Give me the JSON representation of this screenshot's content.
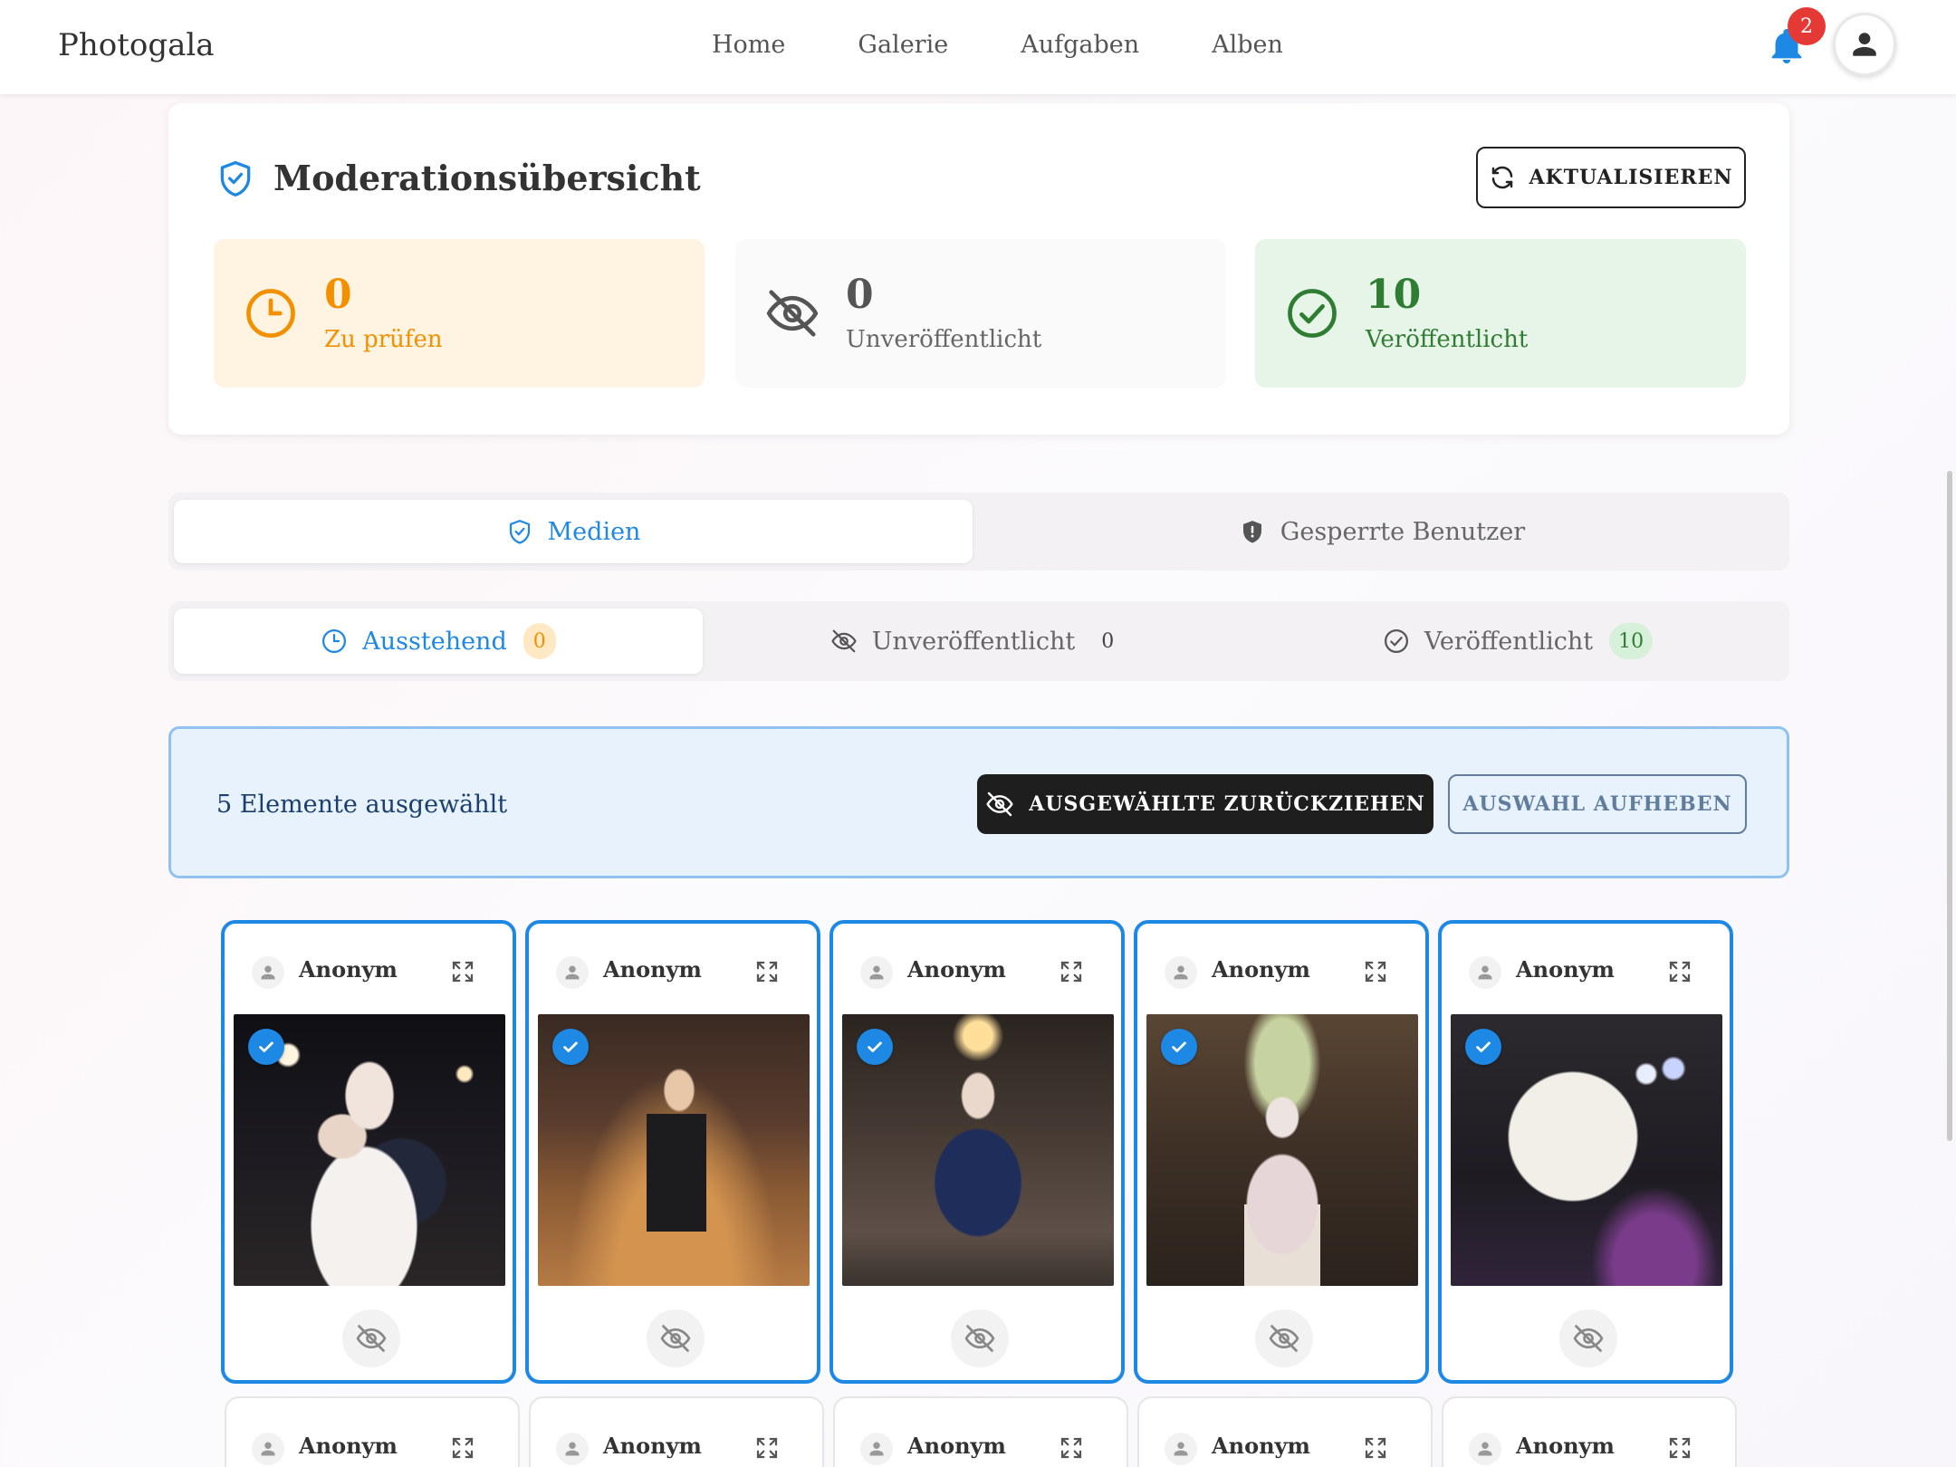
{
  "app": {
    "title": "Photogala"
  },
  "nav": {
    "items": [
      "Home",
      "Galerie",
      "Aufgaben",
      "Alben"
    ]
  },
  "notifications": {
    "count": "2"
  },
  "overview": {
    "title": "Moderationsübersicht",
    "refresh_label": "AKTUALISIEREN",
    "stats": [
      {
        "value": "0",
        "label": "Zu prüfen",
        "icon": "clock-icon",
        "color": "#f29000"
      },
      {
        "value": "0",
        "label": "Unveröffentlicht",
        "icon": "eye-off-icon",
        "color": "#555555"
      },
      {
        "value": "10",
        "label": "Veröffentlicht",
        "icon": "check-circle-icon",
        "color": "#2e7d32"
      }
    ]
  },
  "main_tabs": [
    {
      "label": "Medien",
      "icon": "shield-check-icon",
      "active": true
    },
    {
      "label": "Gesperrte Benutzer",
      "icon": "shield-alert-icon",
      "active": false
    }
  ],
  "status_tabs": [
    {
      "label": "Ausstehend",
      "count": "0",
      "icon": "clock-icon",
      "active": true
    },
    {
      "label": "Unveröffentlicht",
      "count": "0",
      "icon": "eye-off-icon",
      "active": false
    },
    {
      "label": "Veröffentlicht",
      "count": "10",
      "icon": "check-circle-icon",
      "active": false
    }
  ],
  "selection": {
    "text": "5 Elemente ausgewählt",
    "withdraw_label": "AUSGEWÄHLTE ZURÜCKZIEHEN",
    "clear_label": "AUSWAHL AUFHEBEN"
  },
  "media": [
    {
      "user": "Anonym",
      "selected": true,
      "photo": "couple-hug-party"
    },
    {
      "user": "Anonym",
      "selected": true,
      "photo": "boy-dancing-suit"
    },
    {
      "user": "Anonym",
      "selected": true,
      "photo": "grandma-blue-dress-dancing"
    },
    {
      "user": "Anonym",
      "selected": true,
      "photo": "grandma-aisle-dancing"
    },
    {
      "user": "Anonym",
      "selected": true,
      "photo": "bride-dress-shoes"
    },
    {
      "user": "Anonym",
      "selected": false
    },
    {
      "user": "Anonym",
      "selected": false
    },
    {
      "user": "Anonym",
      "selected": false
    },
    {
      "user": "Anonym",
      "selected": false
    },
    {
      "user": "Anonym",
      "selected": false
    }
  ],
  "colors": {
    "accent": "#1e88e5",
    "notification": "#e53935",
    "dark_button": "#1e1e1e"
  }
}
